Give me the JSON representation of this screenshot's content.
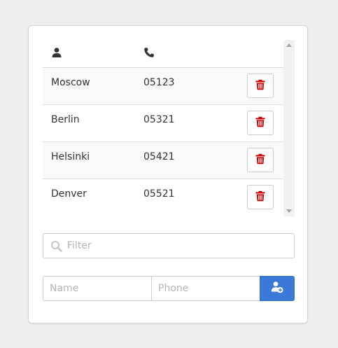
{
  "table": {
    "columns": [
      {
        "icon": "user-icon"
      },
      {
        "icon": "phone-icon"
      }
    ],
    "rows": [
      {
        "name": "Moscow",
        "phone": "05123",
        "action_icon": "trash-icon"
      },
      {
        "name": "Berlin",
        "phone": "05321",
        "action_icon": "trash-icon"
      },
      {
        "name": "Helsinki",
        "phone": "05421",
        "action_icon": "trash-icon"
      },
      {
        "name": "Denver",
        "phone": "05521",
        "action_icon": "trash-icon"
      }
    ]
  },
  "filter": {
    "placeholder": "Filter",
    "value": "",
    "icon": "search-icon"
  },
  "add_form": {
    "name_placeholder": "Name",
    "phone_placeholder": "Phone",
    "add_icon": "add-user-icon"
  },
  "colors": {
    "primary": "#3c78d8",
    "danger": "#cc0000",
    "icon_dark": "#333333",
    "stripe": "#f9f9f9"
  }
}
